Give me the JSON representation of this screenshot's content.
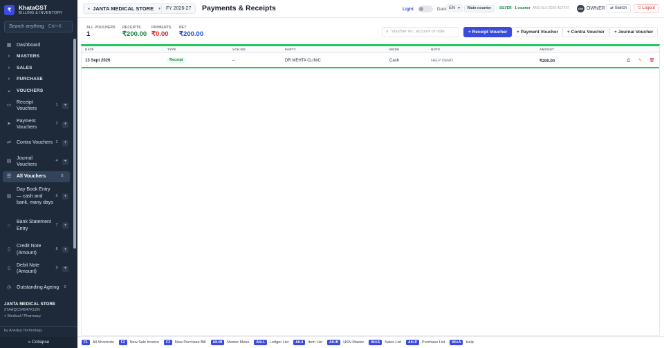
{
  "brand": {
    "logo": "₹",
    "name": "KhatаGST",
    "subtitle": "BILLING & INVENTORY"
  },
  "search": {
    "placeholder": "Search anything",
    "shortcut": "Ctrl+K"
  },
  "nav": {
    "dashboard": "Dashboard",
    "masters": "MASTERS",
    "sales": "SALES",
    "purchase": "PURCHASE",
    "vouchers": "VOUCHERS",
    "items": [
      {
        "label": "Receipt Vouchers",
        "num": "1"
      },
      {
        "label": "Payment Vouchers",
        "num": "2"
      },
      {
        "label": "Contra Vouchers",
        "num": "3"
      },
      {
        "label": "Journal Vouchers",
        "num": "4"
      },
      {
        "label": "All Vouchers",
        "num": "5"
      },
      {
        "label": "Day Book Entry — cash and bank, many days",
        "num": "6"
      },
      {
        "label": "Bank Statement Entry",
        "num": "7"
      },
      {
        "label": "Credit Note (Amount)",
        "num": "8"
      },
      {
        "label": "Debit Note (Amount)",
        "num": "9"
      },
      {
        "label": "Outstanding Ageing",
        "num": "0"
      }
    ]
  },
  "org": {
    "name": "JANTA MEDICAL STORE",
    "gstin": "27AAQCS4547K1ZN",
    "type": "Medical / Pharmacy"
  },
  "footer": {
    "by": "by Anedya Technology",
    "collapse": "« Collapse"
  },
  "topbar": {
    "store": "JANTA MEDICAL STORE",
    "fy": "FY 2026-27",
    "title": "Payments & Receipts",
    "theme_light": "Light",
    "theme_dark": "Dark",
    "lang": "EN",
    "counter": "Main counter",
    "license_tier": "SILVER · 1 counter",
    "license_key": "ANO-SLV-2026-4E7F97",
    "avatar": "OW",
    "user": "OWNER",
    "switch": "⇄ Switch",
    "logout": "⎋ Logout"
  },
  "stats": {
    "all_label": "ALL VOUCHERS",
    "all_value": "1",
    "receipts_label": "RECEIPTS",
    "receipts_value": "₹200.00",
    "payments_label": "PAYMENTS",
    "payments_value": "₹0.00",
    "net_label": "NET",
    "net_value": "₹200.00"
  },
  "actions": {
    "search_placeholder": "Voucher no., account or note",
    "receipt": "+ Receipt Voucher",
    "payment": "+ Payment Voucher",
    "contra": "+ Contra Voucher",
    "journal": "+ Journal Voucher"
  },
  "table": {
    "headers": {
      "date": "DATE",
      "type": "TYPE",
      "vch": "VCH NO.",
      "party": "PARTY",
      "mode": "MODE",
      "note": "NOTE",
      "amount": "AMOUNT"
    },
    "rows": [
      {
        "date": "13 Sept 2026",
        "type": "Receipt",
        "vch": "–",
        "party": "DR MEHTA CLINIC",
        "mode": "Cash",
        "note": "HELP DEMO",
        "amount": "₹200.00"
      }
    ]
  },
  "shortcuts": [
    {
      "key": "F1",
      "label": "All Shortcuts"
    },
    {
      "key": "F2",
      "label": "New Sale Invoice"
    },
    {
      "key": "F3",
      "label": "New Purchase Bill"
    },
    {
      "key": "Alt+M",
      "label": "Master Menu"
    },
    {
      "key": "Alt+L",
      "label": "Ledger List"
    },
    {
      "key": "Alt+I",
      "label": "Item List"
    },
    {
      "key": "Alt+H",
      "label": "HSN Master"
    },
    {
      "key": "Alt+S",
      "label": "Sales List"
    },
    {
      "key": "Alt+P",
      "label": "Purchase List"
    },
    {
      "key": "Alt+A",
      "label": "Help"
    }
  ],
  "colors": {
    "accent": "#3b4bdc",
    "sidebar": "#1e2a3a",
    "success": "#22c55e",
    "danger": "#dc2626"
  }
}
